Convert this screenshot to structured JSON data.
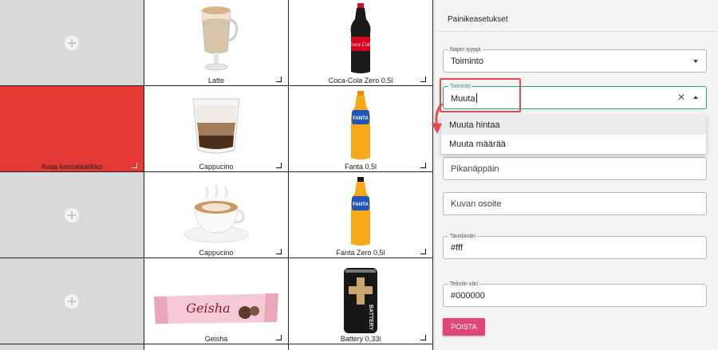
{
  "grid": {
    "cells": [
      {
        "label": ""
      },
      {
        "label": "Latte"
      },
      {
        "label": "Coca-Cola Zero 0,5l"
      },
      {
        "label": "Avaa kassalaatikko"
      },
      {
        "label": "Cappucino"
      },
      {
        "label": "Fanta 0,5l"
      },
      {
        "label": ""
      },
      {
        "label": "Cappucino"
      },
      {
        "label": "Fanta Zero 0,5l"
      },
      {
        "label": ""
      },
      {
        "label": "Geisha"
      },
      {
        "label": "Battery 0,33l"
      }
    ],
    "red_color": "#e53935",
    "geisha_wordmark": "Geisha",
    "battery_wordmark": "BATTERY",
    "fanta_wordmark": "FANTA",
    "coke_wordmark": "Coca-Cola"
  },
  "panel": {
    "title": "Painikeasetukset",
    "button_type": {
      "label": "Napin tyyppi",
      "value": "Toiminto"
    },
    "action": {
      "label": "Toiminto",
      "value": "Muuta"
    },
    "dropdown_options": [
      "Muuta hintaa",
      "Muuta määrää"
    ],
    "shortcut": {
      "placeholder": "Pikanäppäin"
    },
    "image_url": {
      "placeholder": "Kuvan osoite"
    },
    "bg_color": {
      "label": "Taustaväri",
      "value": "#fff"
    },
    "text_color": {
      "label": "Tekstin väri",
      "value": "#000000"
    },
    "delete_label": "POISTA",
    "accent_color": "#2e9e8e",
    "delete_color": "#e0457a"
  }
}
